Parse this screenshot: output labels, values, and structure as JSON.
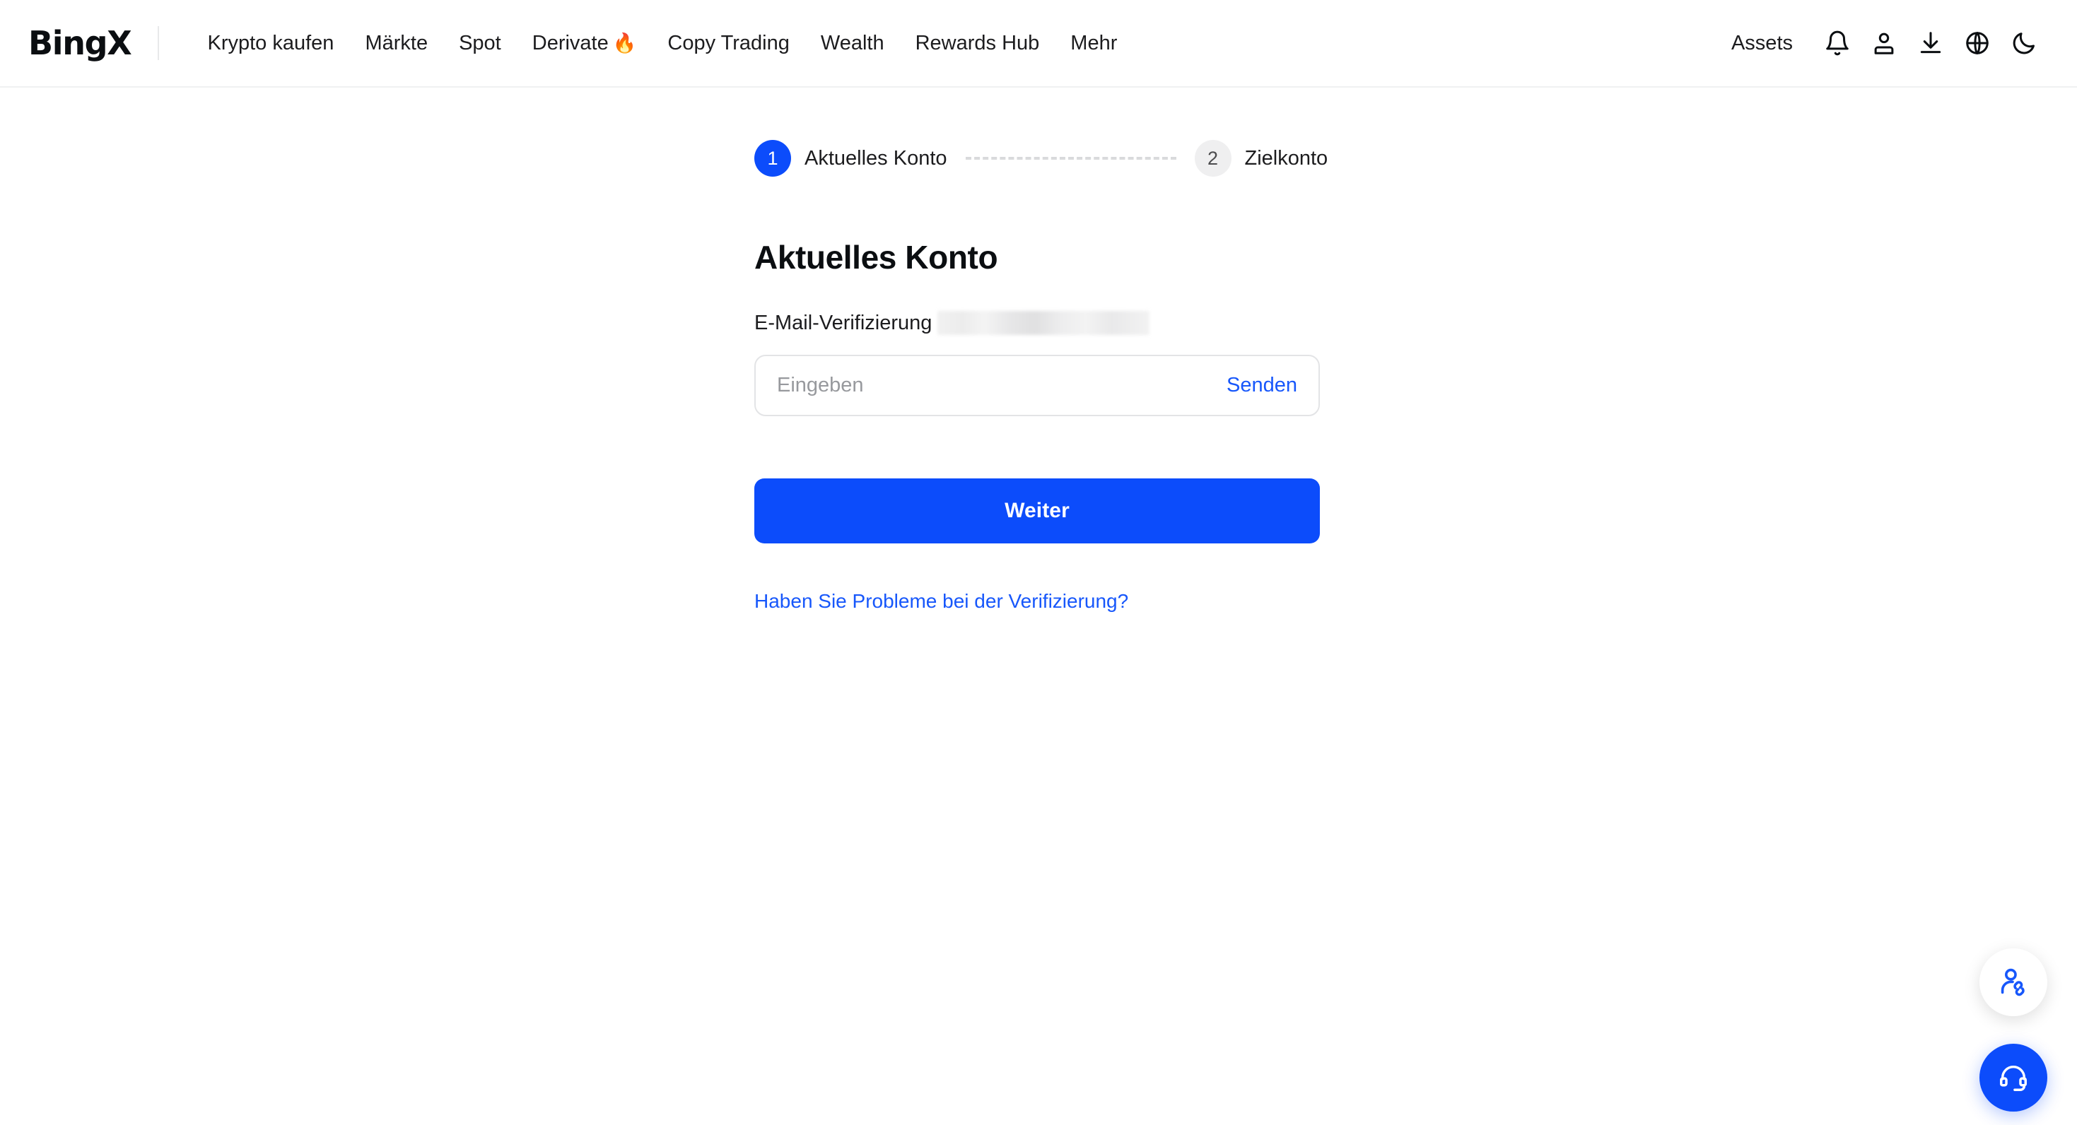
{
  "header": {
    "brand": "BingX",
    "nav_items": [
      {
        "label": "Krypto kaufen",
        "emoji": ""
      },
      {
        "label": "Märkte",
        "emoji": ""
      },
      {
        "label": "Spot",
        "emoji": ""
      },
      {
        "label": "Derivate",
        "emoji": "🔥"
      },
      {
        "label": "Copy Trading",
        "emoji": ""
      },
      {
        "label": "Wealth",
        "emoji": ""
      },
      {
        "label": "Rewards Hub",
        "emoji": ""
      },
      {
        "label": "Mehr",
        "emoji": ""
      }
    ],
    "assets_label": "Assets",
    "icons": [
      "notification-bell-icon",
      "user-profile-icon",
      "download-icon",
      "language-globe-icon",
      "dark-mode-moon-icon"
    ]
  },
  "stepper": {
    "steps": [
      {
        "number": "1",
        "label": "Aktuelles Konto",
        "state": "active"
      },
      {
        "number": "2",
        "label": "Zielkonto",
        "state": "inactive"
      }
    ]
  },
  "form": {
    "title": "Aktuelles Konto",
    "field_label": "E-Mail-Verifizierung",
    "masked_email": "",
    "code_placeholder": "Eingeben",
    "code_value": "",
    "send_label": "Senden",
    "submit_label": "Weiter",
    "help_label": "Haben Sie Probleme bei der Verifizierung?"
  },
  "floating": {
    "referral_icon": "user-referral-link-icon",
    "support_icon": "headset-support-icon"
  },
  "colors": {
    "accent_blue": "#0C4CFB",
    "link_blue": "#1757FB",
    "text_primary": "#1C1C1E",
    "border_gray": "#E3E4E6",
    "inactive_gray": "#EFEFF0",
    "page_background": "#FFFFFF"
  }
}
